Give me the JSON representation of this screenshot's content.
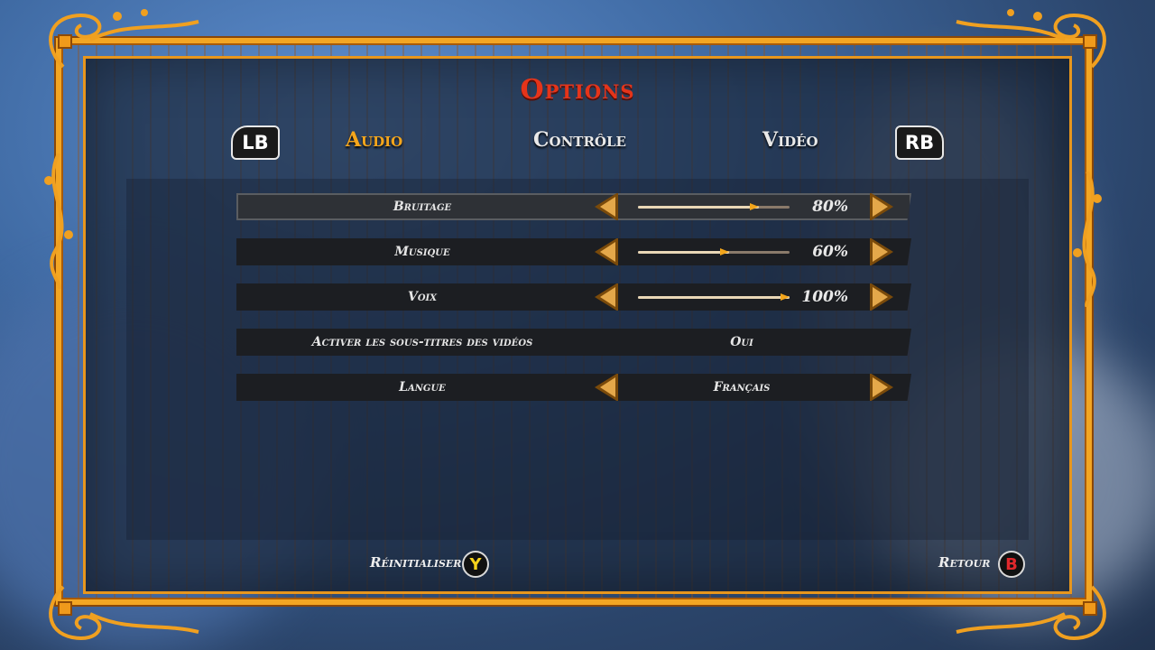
{
  "title": "Options",
  "shoulders": {
    "left": "LB",
    "right": "RB"
  },
  "tabs": [
    {
      "label": "Audio",
      "active": true
    },
    {
      "label": "Contrôle",
      "active": false
    },
    {
      "label": "Vidéo",
      "active": false
    }
  ],
  "settings": [
    {
      "label": "Bruitage",
      "type": "slider",
      "value_pct": 80,
      "display": "80%",
      "selected": true
    },
    {
      "label": "Musique",
      "type": "slider",
      "value_pct": 60,
      "display": "60%",
      "selected": false
    },
    {
      "label": "Voix",
      "type": "slider",
      "value_pct": 100,
      "display": "100%",
      "selected": false
    },
    {
      "label": "Activer les sous-titres des vidéos",
      "type": "toggle",
      "display": "Oui",
      "selected": false
    },
    {
      "label": "Langue",
      "type": "select",
      "display": "Français",
      "selected": false
    }
  ],
  "footer": {
    "reset_label": "Réinitialiser",
    "reset_button": "Y",
    "back_label": "Retour",
    "back_button": "B"
  },
  "colors": {
    "accent": "#f5a61c",
    "title": "#e5341a",
    "frame": "#f3a623",
    "y_button": "#f5d21c",
    "b_button": "#e0282c"
  },
  "icons": [
    "arrow-left-icon",
    "arrow-right-icon",
    "slider-knob-icon",
    "gamepad-y-icon",
    "gamepad-b-icon"
  ]
}
